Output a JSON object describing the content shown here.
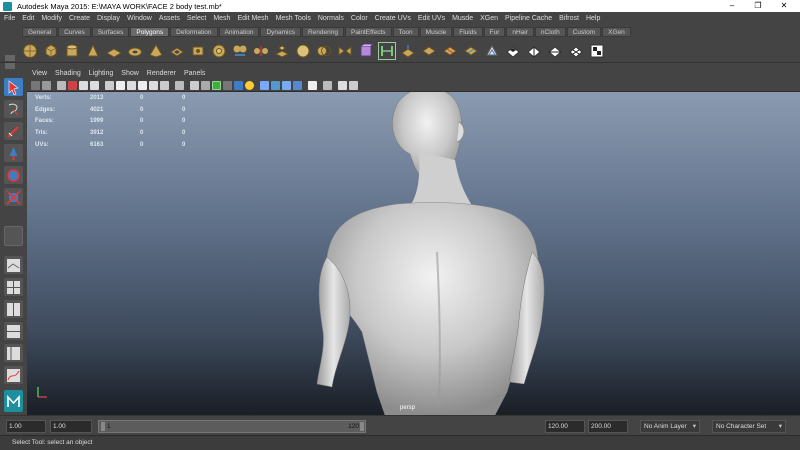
{
  "window": {
    "title": "Autodesk Maya 2015: E:\\MAYA WORK\\FACE 2 body test.mb*",
    "minimize": "–",
    "maximize": "❐",
    "close": "✕"
  },
  "menu": [
    "File",
    "Edit",
    "Modify",
    "Create",
    "Display",
    "Window",
    "Assets",
    "Select",
    "Mesh",
    "Edit Mesh",
    "Mesh Tools",
    "Normals",
    "Color",
    "Create UVs",
    "Edit UVs",
    "Musde",
    "XGen",
    "Pipeline Cache",
    "Bifrost",
    "Help"
  ],
  "shelf": {
    "tabs": [
      "General",
      "Curves",
      "Surfaces",
      "Polygons",
      "Deformation",
      "Animation",
      "Dynamics",
      "Rendering",
      "PaintEffects",
      "Toon",
      "Muscle",
      "Fluids",
      "Fur",
      "nHair",
      "nCloth",
      "Custom",
      "XGen"
    ],
    "active_tab": "Polygons"
  },
  "panel_menu": [
    "View",
    "Shading",
    "Lighting",
    "Show",
    "Renderer",
    "Panels"
  ],
  "hud": {
    "rows": [
      {
        "label": "Verts:",
        "c1": "2013",
        "c2": "0",
        "c3": "0"
      },
      {
        "label": "Edges:",
        "c1": "4021",
        "c2": "0",
        "c3": "0"
      },
      {
        "label": "Faces:",
        "c1": "1999",
        "c2": "0",
        "c3": "0"
      },
      {
        "label": "Tris:",
        "c1": "3912",
        "c2": "0",
        "c3": "0"
      },
      {
        "label": "UVs:",
        "c1": "6163",
        "c2": "0",
        "c3": "0"
      }
    ]
  },
  "viewport": {
    "camera": "persp",
    "axis_y": "y",
    "axis_x": "x"
  },
  "timeline": {
    "start_field": "1.00",
    "current_field": "1.00",
    "range_start": "1",
    "range_end": "120",
    "end_field": "120.00",
    "total_field": "200.00",
    "anim_layer": "No Anim Layer",
    "character_set": "No Character Set"
  },
  "status": {
    "message": "Select Tool: select an object"
  },
  "colors": {
    "ui_bg": "#444444",
    "active_tool": "#3d7dc4",
    "viewport_top": "#8a9bb1",
    "viewport_bottom": "#1a1e25"
  }
}
